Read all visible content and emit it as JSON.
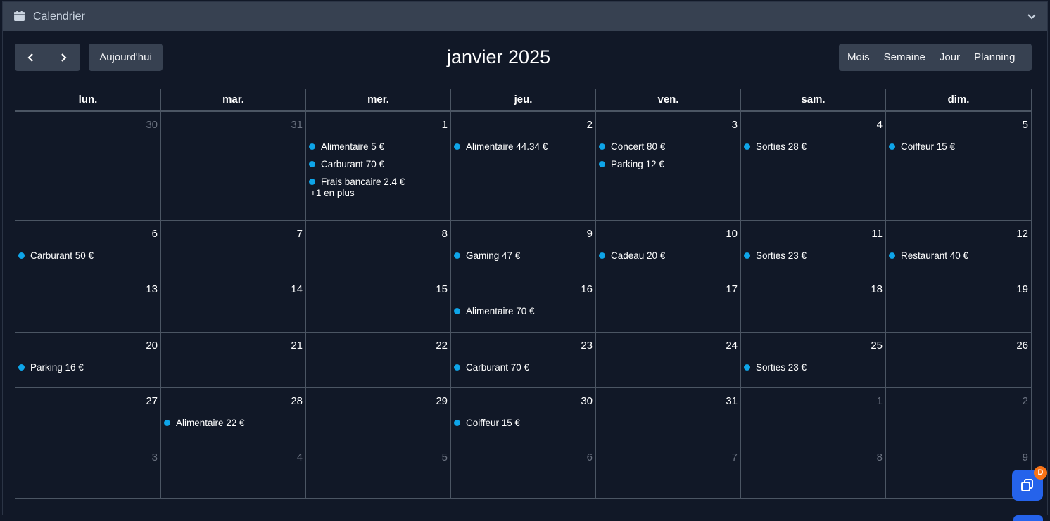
{
  "header": {
    "title": "Calendrier",
    "icon": "calendar-icon"
  },
  "toolbar": {
    "today_label": "Aujourd'hui",
    "month_title": "janvier 2025",
    "views": [
      "Mois",
      "Semaine",
      "Jour",
      "Planning"
    ]
  },
  "weekdays": [
    "lun.",
    "mar.",
    "mer.",
    "jeu.",
    "ven.",
    "sam.",
    "dim."
  ],
  "colors": {
    "event_dot": "#0ea5e9",
    "accent": "#2563eb",
    "badge": "#f97316"
  },
  "weeks": [
    [
      {
        "day": "30",
        "other": true,
        "events": []
      },
      {
        "day": "31",
        "other": true,
        "events": []
      },
      {
        "day": "1",
        "events": [
          "Alimentaire 5 €",
          "Carburant 70 €",
          "Frais bancaire 2.4 €"
        ],
        "more": "+1 en plus"
      },
      {
        "day": "2",
        "events": [
          "Alimentaire 44.34 €"
        ]
      },
      {
        "day": "3",
        "events": [
          "Concert 80 €",
          "Parking 12 €"
        ]
      },
      {
        "day": "4",
        "events": [
          "Sorties 28 €"
        ]
      },
      {
        "day": "5",
        "events": [
          "Coiffeur 15 €"
        ]
      }
    ],
    [
      {
        "day": "6",
        "events": [
          "Carburant 50 €"
        ]
      },
      {
        "day": "7",
        "events": []
      },
      {
        "day": "8",
        "events": []
      },
      {
        "day": "9",
        "events": [
          "Gaming 47 €"
        ]
      },
      {
        "day": "10",
        "events": [
          "Cadeau 20 €"
        ]
      },
      {
        "day": "11",
        "events": [
          "Sorties 23 €"
        ]
      },
      {
        "day": "12",
        "events": [
          "Restaurant 40 €"
        ]
      }
    ],
    [
      {
        "day": "13",
        "events": []
      },
      {
        "day": "14",
        "events": []
      },
      {
        "day": "15",
        "events": []
      },
      {
        "day": "16",
        "events": [
          "Alimentaire 70 €"
        ]
      },
      {
        "day": "17",
        "events": []
      },
      {
        "day": "18",
        "events": []
      },
      {
        "day": "19",
        "events": []
      }
    ],
    [
      {
        "day": "20",
        "events": [
          "Parking 16 €"
        ]
      },
      {
        "day": "21",
        "events": []
      },
      {
        "day": "22",
        "events": []
      },
      {
        "day": "23",
        "events": [
          "Carburant 70 €"
        ]
      },
      {
        "day": "24",
        "events": []
      },
      {
        "day": "25",
        "events": [
          "Sorties 23 €"
        ]
      },
      {
        "day": "26",
        "events": []
      }
    ],
    [
      {
        "day": "27",
        "events": []
      },
      {
        "day": "28",
        "events": [
          "Alimentaire 22 €"
        ]
      },
      {
        "day": "29",
        "events": []
      },
      {
        "day": "30",
        "events": [
          "Coiffeur 15 €"
        ]
      },
      {
        "day": "31",
        "events": []
      },
      {
        "day": "1",
        "other": true,
        "events": []
      },
      {
        "day": "2",
        "other": true,
        "events": []
      }
    ],
    [
      {
        "day": "3",
        "other": true,
        "events": []
      },
      {
        "day": "4",
        "other": true,
        "events": []
      },
      {
        "day": "5",
        "other": true,
        "events": []
      },
      {
        "day": "6",
        "other": true,
        "events": []
      },
      {
        "day": "7",
        "other": true,
        "events": []
      },
      {
        "day": "8",
        "other": true,
        "events": []
      },
      {
        "day": "9",
        "other": true,
        "events": []
      }
    ]
  ],
  "fab": {
    "badge": "D",
    "icon": "copy-icon"
  }
}
